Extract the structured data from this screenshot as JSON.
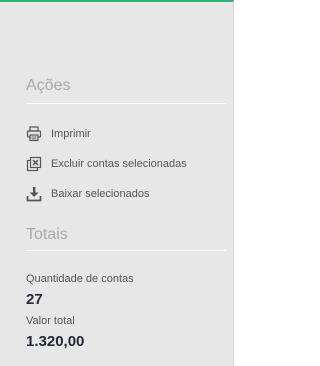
{
  "actions": {
    "title": "Ações",
    "items": [
      {
        "label": "Imprimir",
        "icon": "printer-icon"
      },
      {
        "label": "Excluir contas selecionadas",
        "icon": "delete-selected-icon"
      },
      {
        "label": "Baixar selecionados",
        "icon": "download-icon"
      }
    ]
  },
  "totals": {
    "title": "Totais",
    "count_label": "Quantidade de contas",
    "count_value": "27",
    "total_label": "Valor total",
    "total_value": "1.320,00"
  },
  "colors": {
    "accent": "#2fb06e",
    "panel_bg": "#e7e7e7",
    "section_title": "#aaaaaa",
    "value_text": "#222a3a"
  }
}
